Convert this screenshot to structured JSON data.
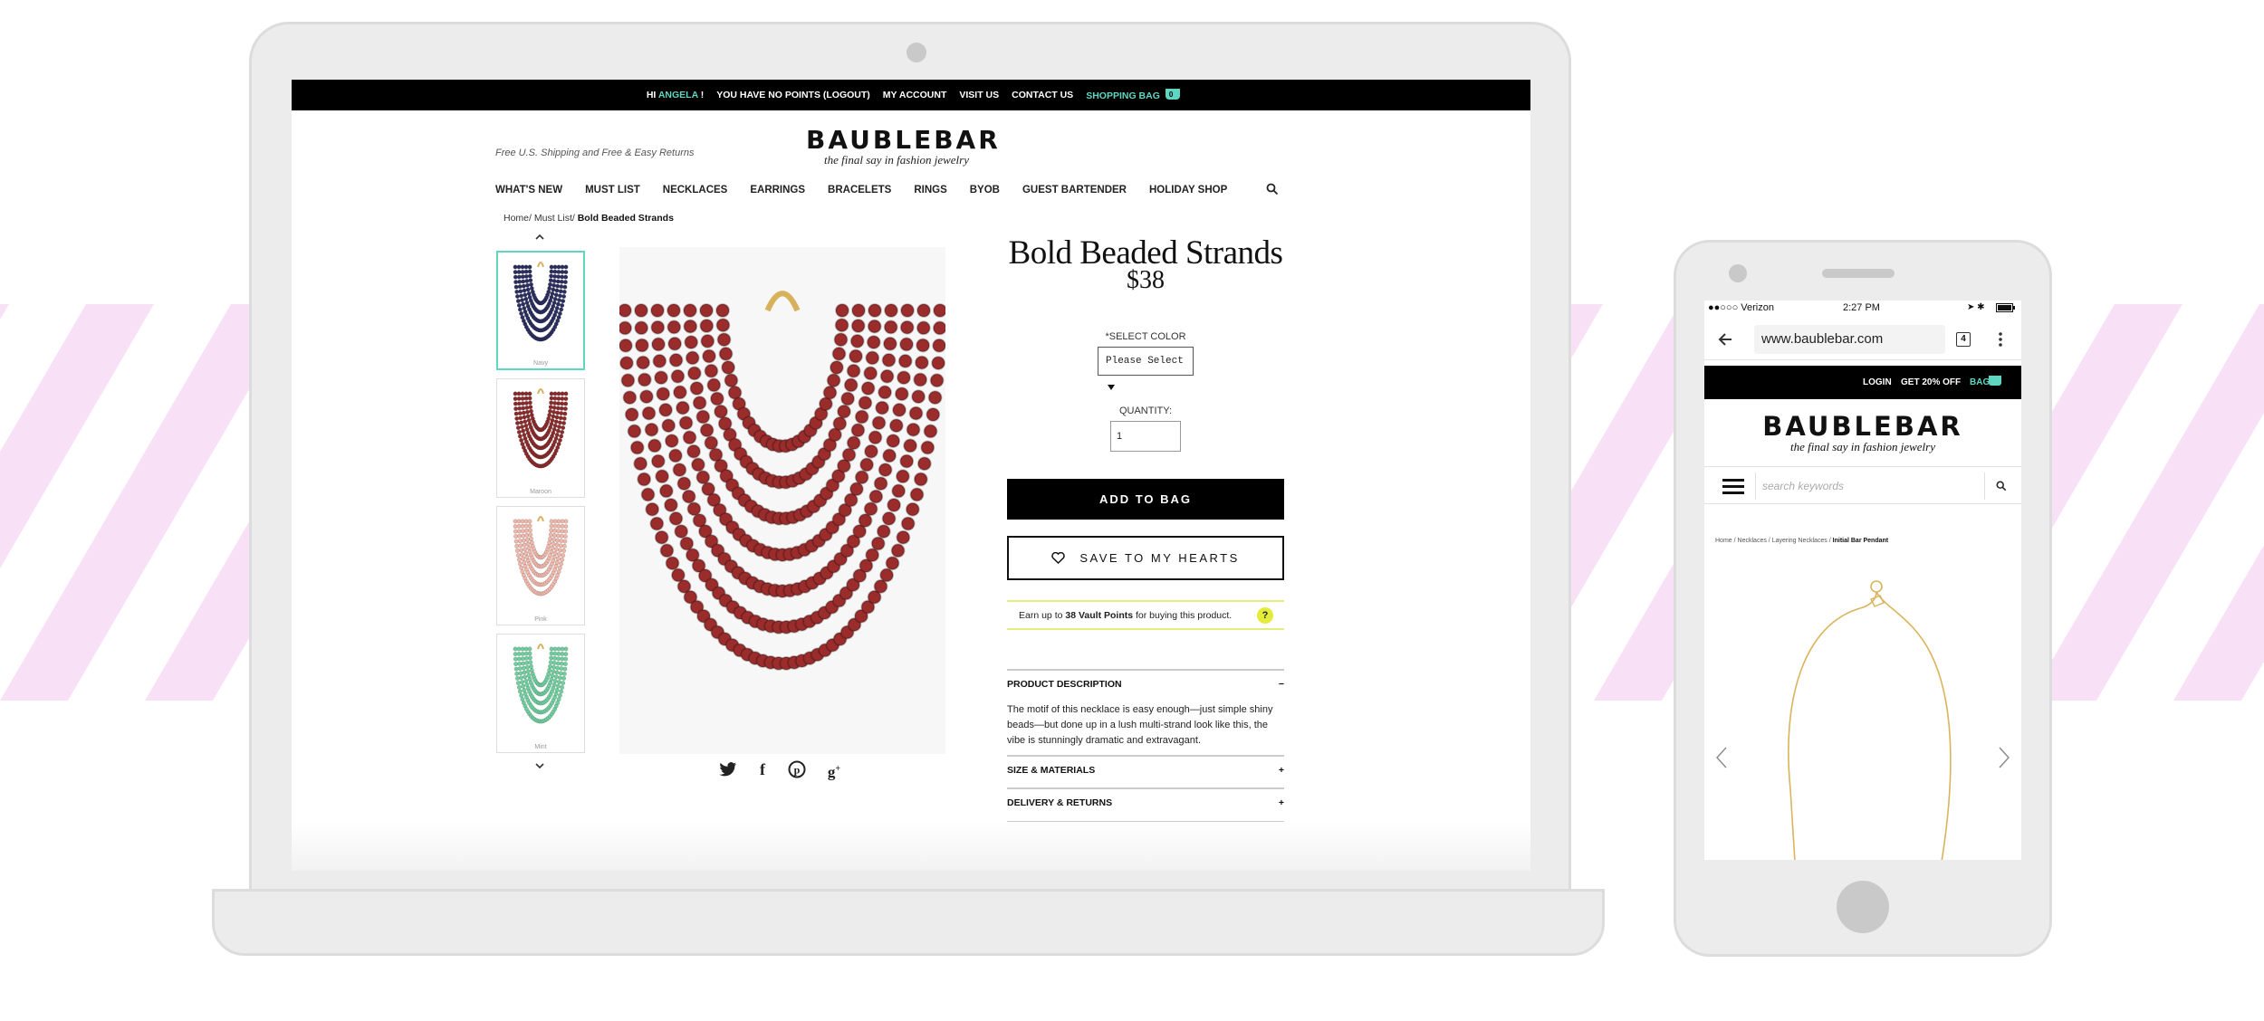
{
  "desktop": {
    "topbar": {
      "greeting_prefix": "HI",
      "user_name": "ANGELA",
      "greeting_suffix": "!",
      "points_message": "YOU HAVE NO POINTS (LOGOUT)",
      "my_account": "MY ACCOUNT",
      "visit_us": "VISIT US",
      "contact_us": "CONTACT US",
      "shopping_bag": "SHOPPING BAG",
      "bag_count": "0"
    },
    "shipping_note": "Free U.S. Shipping and Free & Easy Returns",
    "logo": {
      "word": "BAUBLEBAR",
      "tagline": "the final say in fashion jewelry"
    },
    "nav": [
      "WHAT'S NEW",
      "MUST LIST",
      "NECKLACES",
      "EARRINGS",
      "BRACELETS",
      "RINGS",
      "BYOB",
      "GUEST BARTENDER",
      "HOLIDAY SHOP"
    ],
    "breadcrumb": {
      "home": "Home",
      "must_list": "Must List",
      "current": "Bold Beaded Strands",
      "sep": "/"
    },
    "thumbnails": [
      {
        "caption": "Navy",
        "color": "#2b2e5e"
      },
      {
        "caption": "Maroon",
        "color": "#8a2b2b"
      },
      {
        "caption": "Pink",
        "color": "#f2b8ac"
      },
      {
        "caption": "Mint",
        "color": "#6fcf9f"
      }
    ],
    "main_necklace_color": "#9a2c2c",
    "share_icons": [
      "twitter-icon",
      "facebook-icon",
      "pinterest-icon",
      "google-plus-icon"
    ],
    "product": {
      "title": "Bold Beaded Strands",
      "price": "$38",
      "select_color_label": "*SELECT COLOR",
      "select_value": "Please Select",
      "quantity_label": "QUANTITY:",
      "quantity_value": "1",
      "add_to_bag": "ADD TO BAG",
      "save_to_hearts": "SAVE TO MY HEARTS",
      "vault_prefix": "Earn up to",
      "vault_points": "38 Vault Points",
      "vault_suffix": "for buying this product.",
      "vault_help": "?"
    },
    "accordion": [
      {
        "title": "PRODUCT DESCRIPTION",
        "toggle": "−",
        "body": "The motif of this necklace is easy enough—just simple shiny beads—but done up in a lush multi-strand look like this, the vibe is stunningly dramatic and extravagant."
      },
      {
        "title": "SIZE & MATERIALS",
        "toggle": "+"
      },
      {
        "title": "DELIVERY & RETURNS",
        "toggle": "+"
      }
    ]
  },
  "mobile": {
    "status": {
      "carrier": "●●○○○ Verizon",
      "time": "2:27 PM"
    },
    "url": "www.baublebar.com",
    "tab_count": "4",
    "blackbar": {
      "login": "LOGIN",
      "promo": "GET 20% OFF",
      "bag": "BAG"
    },
    "logo": {
      "word": "BAUBLEBAR",
      "tagline": "the final say in fashion jewelry"
    },
    "search_placeholder": "search keywords",
    "breadcrumb": {
      "home": "Home",
      "necklaces": "Necklaces",
      "layering": "Layering Necklaces",
      "current": "Initial Bar Pendant",
      "sep": "/"
    }
  },
  "colors": {
    "accent": "#5fd6c2",
    "vault_yellow": "#e3ec3a",
    "stripe_pink": "#f8e1f6"
  }
}
